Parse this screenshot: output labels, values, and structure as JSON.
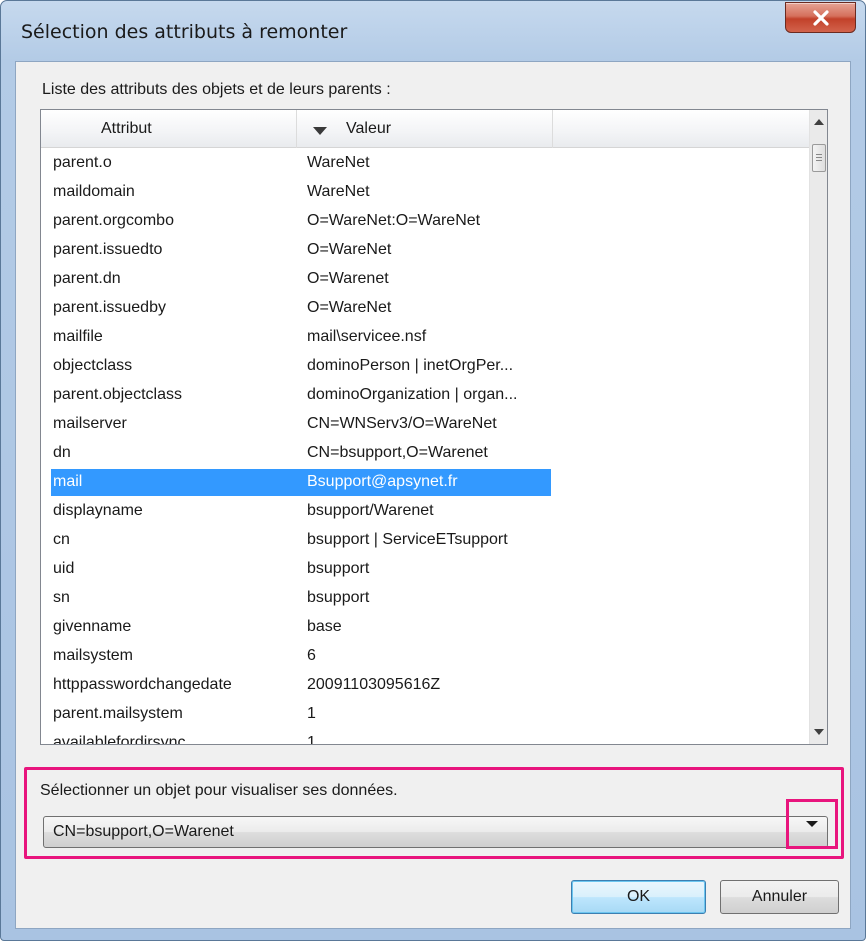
{
  "window": {
    "title": "Sélection des attributs à remonter"
  },
  "list": {
    "caption": "Liste des attributs des objets et de leurs parents :",
    "columns": {
      "attribute": "Attribut",
      "value": "Valeur"
    },
    "rows": [
      {
        "attr": "parent.o",
        "value": "WareNet"
      },
      {
        "attr": "maildomain",
        "value": "WareNet"
      },
      {
        "attr": "parent.orgcombo",
        "value": "O=WareNet:O=WareNet"
      },
      {
        "attr": "parent.issuedto",
        "value": "O=WareNet"
      },
      {
        "attr": "parent.dn",
        "value": "O=Warenet"
      },
      {
        "attr": "parent.issuedby",
        "value": "O=WareNet"
      },
      {
        "attr": "mailfile",
        "value": "mail\\servicee.nsf"
      },
      {
        "attr": "objectclass",
        "value": "dominoPerson | inetOrgPer..."
      },
      {
        "attr": "parent.objectclass",
        "value": "dominoOrganization | organ..."
      },
      {
        "attr": "mailserver",
        "value": "CN=WNServ3/O=WareNet"
      },
      {
        "attr": "dn",
        "value": "CN=bsupport,O=Warenet"
      },
      {
        "attr": "mail",
        "value": "Bsupport@apsynet.fr"
      },
      {
        "attr": "displayname",
        "value": "bsupport/Warenet"
      },
      {
        "attr": "cn",
        "value": "bsupport | ServiceETsupport"
      },
      {
        "attr": "uid",
        "value": "bsupport"
      },
      {
        "attr": "sn",
        "value": "bsupport"
      },
      {
        "attr": "givenname",
        "value": "base"
      },
      {
        "attr": "mailsystem",
        "value": "6"
      },
      {
        "attr": "httppasswordchangedate",
        "value": "20091103095616Z"
      },
      {
        "attr": "parent.mailsystem",
        "value": "1"
      },
      {
        "attr": "availablefordirsync",
        "value": "1"
      }
    ],
    "selected_attr": "mail"
  },
  "object_selector": {
    "caption": "Sélectionner un objet pour visualiser ses données.",
    "selected_value": "CN=bsupport,O=Warenet"
  },
  "buttons": {
    "ok": "OK",
    "cancel": "Annuler"
  },
  "colors": {
    "highlight": "#e8157d",
    "selection": "#3399ff"
  }
}
